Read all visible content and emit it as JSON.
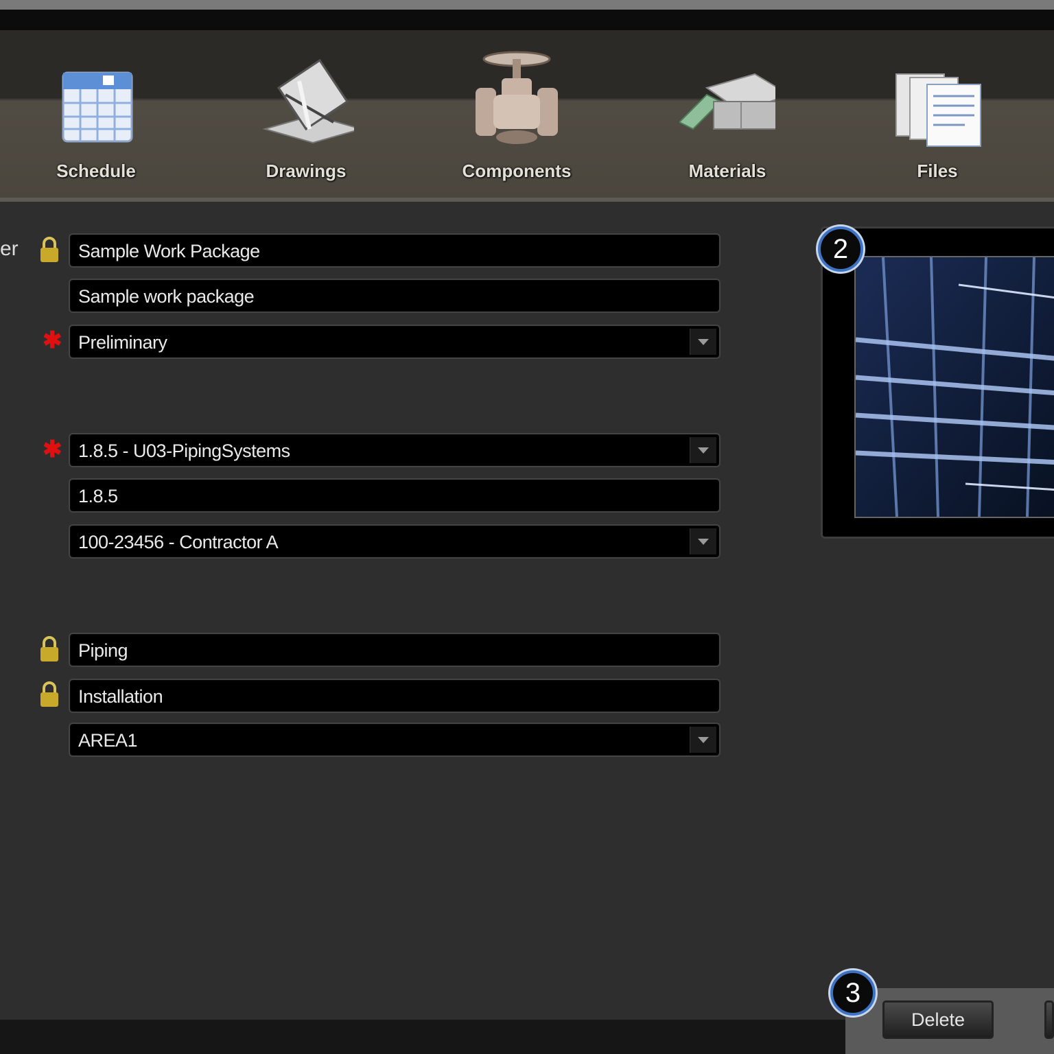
{
  "toolbar": {
    "items": [
      {
        "label": "Schedule",
        "icon": "calendar-icon"
      },
      {
        "label": "Drawings",
        "icon": "drawing-icon"
      },
      {
        "label": "Components",
        "icon": "valve-icon"
      },
      {
        "label": "Materials",
        "icon": "beam-icon"
      },
      {
        "label": "Files",
        "icon": "files-icon"
      }
    ]
  },
  "form": {
    "partial_label": "er",
    "name": "Sample Work Package",
    "description": "Sample work package",
    "status": "Preliminary",
    "system": "1.8.5 - U03-PipingSystems",
    "wbs": "1.8.5",
    "contractor": "100-23456 - Contractor A",
    "discipline": "Piping",
    "work_type": "Installation",
    "area": "AREA1"
  },
  "preview": {
    "callout": "2"
  },
  "footer": {
    "callout": "3",
    "delete_label": "Delete"
  },
  "colors": {
    "required": "#e01010",
    "callout_ring": "#3d73c4",
    "lock": "#c9a92a"
  }
}
